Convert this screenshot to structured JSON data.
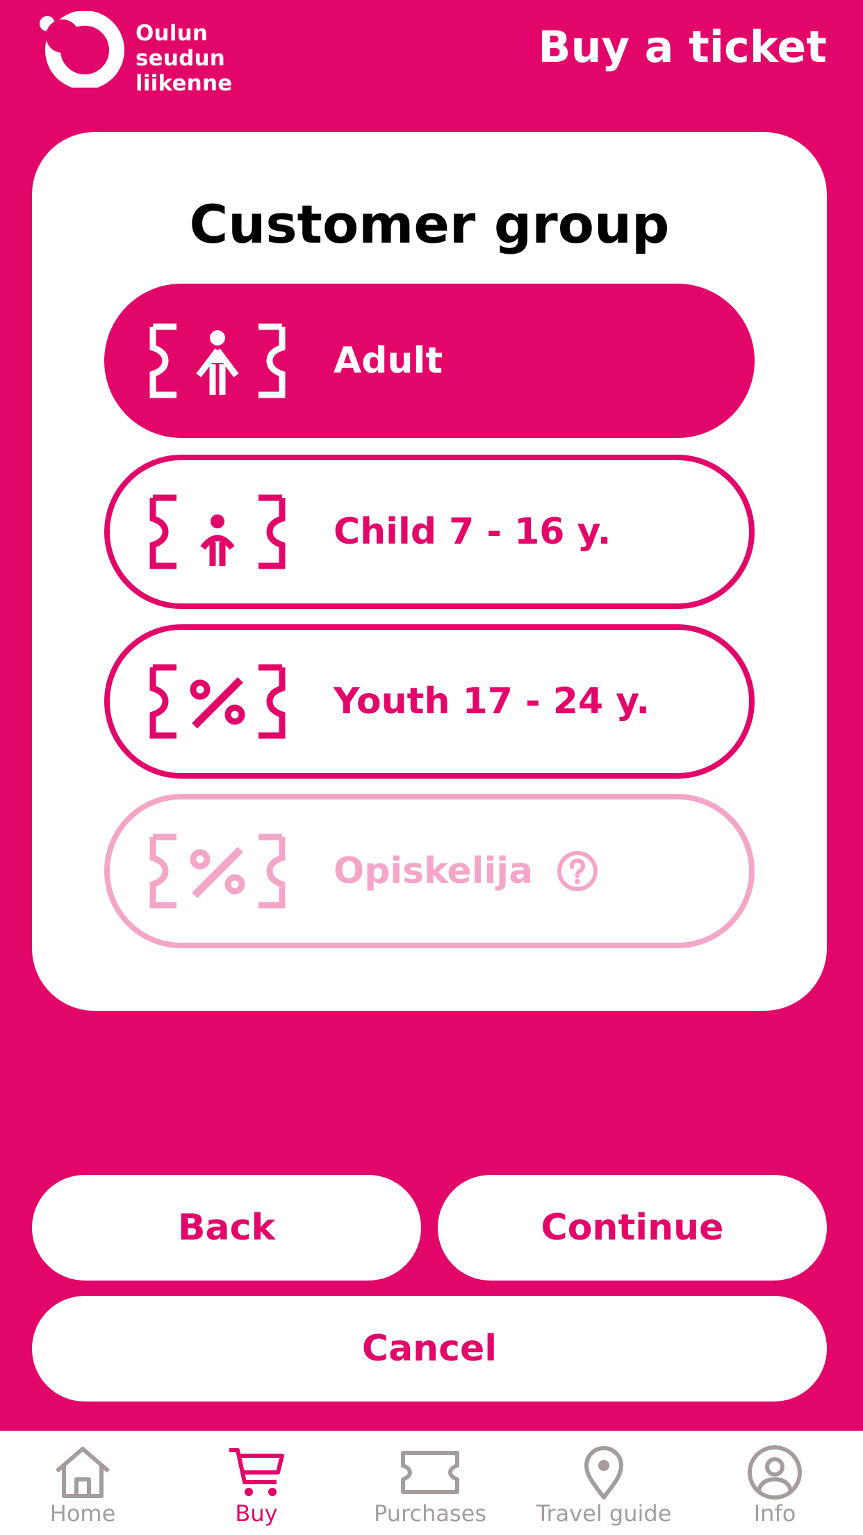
{
  "header": {
    "logo_lines": [
      "Oulun",
      "seudun",
      "liikenne"
    ],
    "title": "Buy a ticket"
  },
  "card": {
    "title": "Customer group",
    "options": [
      {
        "label": "Adult",
        "icon": "ticket-adult-icon",
        "state": "selected"
      },
      {
        "label": "Child 7 - 16 y.",
        "icon": "ticket-child-icon",
        "state": "default"
      },
      {
        "label": "Youth 17 - 24 y.",
        "icon": "ticket-discount-icon",
        "state": "default"
      },
      {
        "label": "Opiskelija",
        "icon": "ticket-discount-icon",
        "state": "disabled",
        "help_icon": "question-circle-icon"
      }
    ]
  },
  "actions": {
    "back_label": "Back",
    "continue_label": "Continue",
    "cancel_label": "Cancel"
  },
  "nav": {
    "items": [
      {
        "label": "Home",
        "icon": "home-icon",
        "active": false
      },
      {
        "label": "Buy",
        "icon": "cart-icon",
        "active": true
      },
      {
        "label": "Purchases",
        "icon": "ticket-icon",
        "active": false
      },
      {
        "label": "Travel guide",
        "icon": "map-pin-icon",
        "active": false
      },
      {
        "label": "Info",
        "icon": "user-circle-icon",
        "active": false
      }
    ]
  },
  "colors": {
    "brand": "#E2056A",
    "brand_light": "#F4A6C8",
    "nav_inactive": "#A59C9C",
    "surface": "#FFFFFF"
  }
}
